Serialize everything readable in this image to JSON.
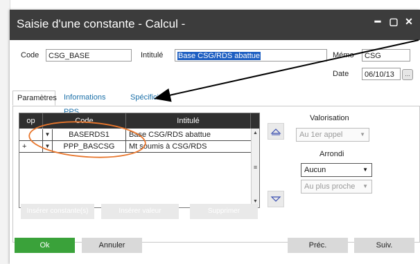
{
  "window": {
    "title": "Saisie d'une constante - Calcul -",
    "minimize_glyph": "━",
    "restore_glyph": "▢",
    "close_glyph": "✕"
  },
  "fields": {
    "code_label": "Code",
    "code_value": "CSG_BASE",
    "intitule_label": "Intitulé",
    "intitule_value": "Base CSG/RDS abattue",
    "memo_label": "Mémo",
    "memo_value": "CSG",
    "date_label": "Date",
    "date_value": "06/10/13"
  },
  "tabs": [
    "Paramètres",
    "Informations PPS",
    "Spécificité"
  ],
  "grid": {
    "headers": [
      "op",
      "Code",
      "Intitulé"
    ],
    "rows": [
      {
        "op": "",
        "code": "BASERDS1",
        "intitule": "Base CSG/RDS abattue"
      },
      {
        "op": "+",
        "code": "PPP_BASCSG",
        "intitule": "Mt soumis à CSG/RDS"
      }
    ]
  },
  "grid_buttons": [
    "Insérer constante(s)",
    "Insérer valeur",
    "Supprimer"
  ],
  "valorisation": {
    "label": "Valorisation",
    "value": "Au 1er appel"
  },
  "arrondi": {
    "label": "Arrondi",
    "value": "Aucun",
    "mode": "Au plus proche"
  },
  "bottom_buttons": {
    "ok": "Ok",
    "annuler": "Annuler",
    "prec": "Préc.",
    "suiv": "Suiv."
  },
  "colors": {
    "titlebar": "#3c3c3c",
    "ok_green": "#3aa23a",
    "annotation_orange": "#e8762c"
  }
}
